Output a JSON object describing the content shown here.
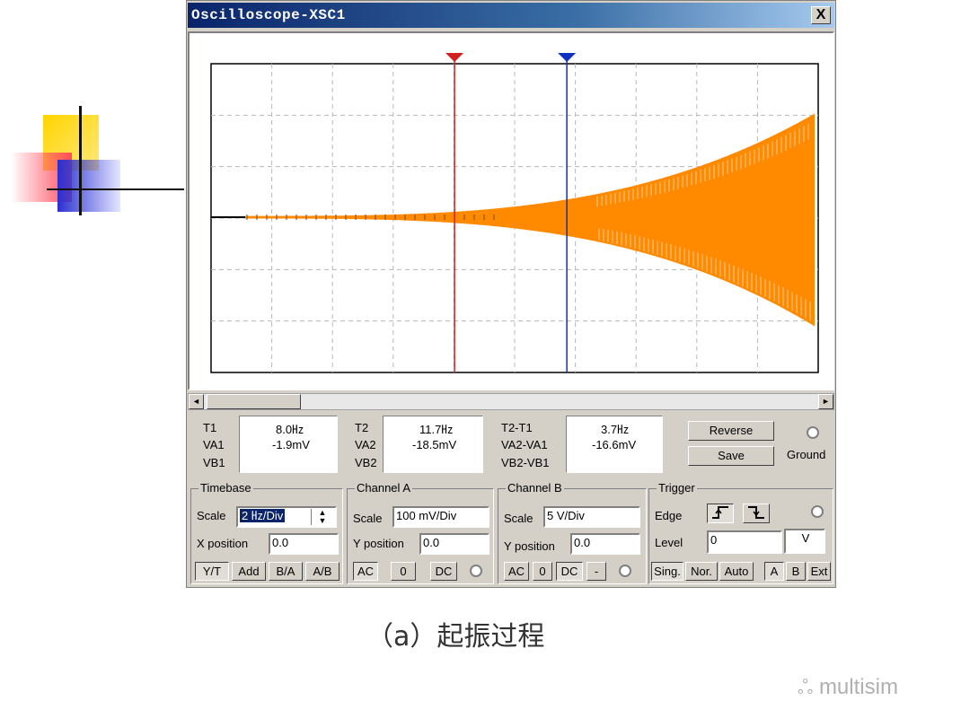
{
  "window": {
    "title": "Oscilloscope-XSC1",
    "close_label": "X"
  },
  "scroll": {
    "left_arrow": "◄",
    "right_arrow": "►"
  },
  "cursors": {
    "t1": {
      "label": "T1",
      "time": "8.0㎐",
      "va": "-1.9mV",
      "row2": "VA1",
      "row3": "VB1"
    },
    "t2": {
      "label": "T2",
      "time": "11.7㎐",
      "va": "-18.5mV",
      "row2": "VA2",
      "row3": "VB2"
    },
    "delta": {
      "label": "T2-T1",
      "time": "3.7㎐",
      "va": "-16.6mV",
      "row2": "VA2-VA1",
      "row3": "VB2-VB1"
    },
    "reverse_label": "Reverse",
    "save_label": "Save",
    "ground_label": "Ground",
    "t1_color": "#d02020",
    "t2_color": "#1030c0"
  },
  "timebase": {
    "title": "Timebase",
    "scale_label": "Scale",
    "scale_value": "2 ㎐/Div",
    "xpos_label": "X position",
    "xpos_value": "0.0",
    "modes": [
      "Y/T",
      "Add",
      "B/A",
      "A/B"
    ]
  },
  "channel_a": {
    "title": "Channel A",
    "scale_label": "Scale",
    "scale_value": "100 mV/Div",
    "ypos_label": "Y position",
    "ypos_value": "0.0",
    "coupling": [
      "AC",
      "0",
      "DC"
    ]
  },
  "channel_b": {
    "title": "Channel B",
    "scale_label": "Scale",
    "scale_value": "5 V/Div",
    "ypos_label": "Y position",
    "ypos_value": "0.0",
    "coupling": [
      "AC",
      "0",
      "DC",
      "-"
    ]
  },
  "trigger": {
    "title": "Trigger",
    "edge_label": "Edge",
    "level_label": "Level",
    "level_value": "0",
    "level_unit": "V",
    "modes": [
      "Sing.",
      "Nor.",
      "Auto"
    ],
    "sources": [
      "A",
      "B",
      "Ext"
    ]
  },
  "trace": {
    "color": "#ff8a00"
  },
  "caption": "（a）起振过程",
  "watermark": "multisim"
}
